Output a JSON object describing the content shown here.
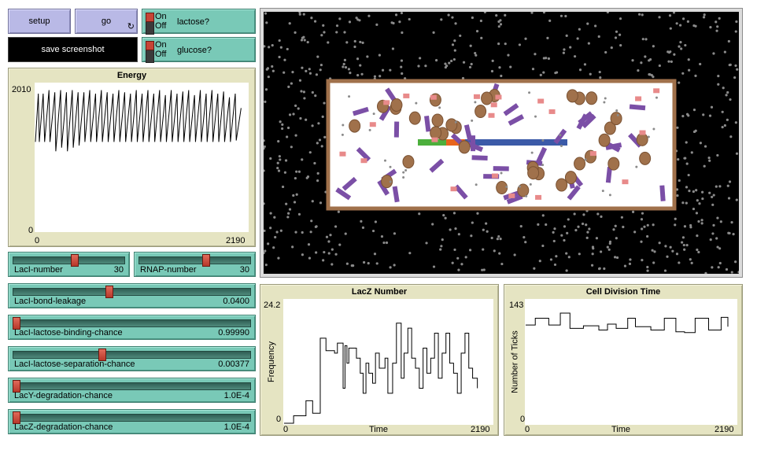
{
  "buttons": {
    "setup": "setup",
    "go": "go",
    "save_screenshot": "save screenshot"
  },
  "switches": [
    {
      "on": "On",
      "off": "Off",
      "label": "lactose?"
    },
    {
      "on": "On",
      "off": "Off",
      "label": "glucose?"
    }
  ],
  "energy_plot": {
    "title": "Energy",
    "y_max": "2010",
    "y_min": "0",
    "x_min": "0",
    "x_max": "2190"
  },
  "sliders": {
    "laci_number": {
      "name": "LacI-number",
      "value": "30",
      "fraction": 0.55
    },
    "rnap_number": {
      "name": "RNAP-number",
      "value": "30",
      "fraction": 0.6
    },
    "laci_bond_leakage": {
      "name": "LacI-bond-leakage",
      "value": "0.0400",
      "fraction": 0.4
    },
    "laci_lactose_binding": {
      "name": "LacI-lactose-binding-chance",
      "value": "0.99990",
      "fraction": 0.0
    },
    "laci_lactose_separation": {
      "name": "LacI-lactose-separation-chance",
      "value": "0.00377",
      "fraction": 0.37
    },
    "lacy_degradation": {
      "name": "LacY-degradation-chance",
      "value": "1.0E-4",
      "fraction": 0.0
    },
    "lacz_degradation": {
      "name": "LacZ-degradation-chance",
      "value": "1.0E-4",
      "fraction": 0.0
    }
  },
  "lacz_plot": {
    "title": "LacZ Number",
    "y_label": "Frequency",
    "x_label": "Time",
    "y_max": "24.2",
    "y_min": "0",
    "x_min": "0",
    "x_max": "2190"
  },
  "division_plot": {
    "title": "Cell Division Time",
    "y_label": "Number of Ticks",
    "x_label": "Time",
    "y_max": "143",
    "y_min": "0",
    "x_min": "0",
    "x_max": "2190"
  },
  "colors": {
    "button": "#b9b9e6",
    "switch": "#79c9b7",
    "plot_bg": "#e5e4c2",
    "cell_wall": "#a0714b",
    "laci": "#7b4fa6",
    "lacy": "#a0714b",
    "lacz": "#e88a8a"
  },
  "chart_data": [
    {
      "type": "line",
      "title": "Energy",
      "xlim": [
        0,
        2190
      ],
      "ylim": [
        0,
        2010
      ],
      "series": [
        {
          "x": [
            0,
            30,
            40,
            80,
            95,
            140,
            150,
            200,
            210,
            260,
            270,
            320,
            330,
            380,
            390,
            440,
            450,
            500,
            510,
            560,
            570,
            620,
            630,
            680,
            690,
            740,
            750,
            800,
            810,
            860,
            870,
            920,
            930,
            980,
            990,
            1040,
            1050,
            1100,
            1110,
            1160,
            1170,
            1220,
            1230,
            1280,
            1290,
            1340,
            1350,
            1400,
            1410,
            1460,
            1470,
            1520,
            1530,
            1580,
            1590,
            1640,
            1650,
            1700,
            1710,
            1760,
            1770,
            1820,
            1830,
            1880,
            1890,
            1940,
            1950,
            2000,
            2010,
            2060,
            2070,
            2120
          ],
          "values": [
            1230,
            1900,
            1230,
            1900,
            1230,
            1950,
            1230,
            1920,
            1100,
            1950,
            1150,
            1920,
            1100,
            1950,
            1150,
            1920,
            1180,
            1920,
            1230,
            1950,
            1230,
            1900,
            1230,
            1950,
            1230,
            1920,
            1230,
            1900,
            1230,
            1950,
            1230,
            1920,
            1230,
            1900,
            1230,
            1950,
            1230,
            1900,
            1230,
            1950,
            1230,
            1900,
            1230,
            1950,
            1230,
            1880,
            1230,
            1950,
            1230,
            1900,
            1230,
            1930,
            1230,
            1950,
            1230,
            1880,
            1230,
            1950,
            1230,
            1900,
            1230,
            1950,
            1230,
            1900,
            1230,
            1930,
            1230,
            1850,
            1230,
            1900,
            1250,
            1700
          ]
        }
      ]
    },
    {
      "type": "line",
      "title": "LacZ Number",
      "xlabel": "Time",
      "ylabel": "Frequency",
      "xlim": [
        0,
        2190
      ],
      "ylim": [
        0,
        24.2
      ],
      "series": [
        {
          "x": [
            0,
            100,
            230,
            300,
            380,
            440,
            530,
            560,
            620,
            640,
            660,
            680,
            760,
            800,
            830,
            860,
            890,
            930,
            960,
            1000,
            1060,
            1090,
            1140,
            1180,
            1230,
            1260,
            1300,
            1340,
            1380,
            1420,
            1460,
            1500,
            1540,
            1580,
            1620,
            1660,
            1700,
            1740,
            1780,
            1820,
            1860,
            1900,
            1940,
            1980,
            2030
          ],
          "values": [
            0,
            1.5,
            4.5,
            2.0,
            17.0,
            14.5,
            14.0,
            16.0,
            7.0,
            15.5,
            12.0,
            15.0,
            13.0,
            10.0,
            6.0,
            12.0,
            10.0,
            8.0,
            14.0,
            11.0,
            13.0,
            6.0,
            12.0,
            20.0,
            9.0,
            14.0,
            19.0,
            13.0,
            11.0,
            7.0,
            15.0,
            10.0,
            13.0,
            18.0,
            9.0,
            14.0,
            18.0,
            12.0,
            10.0,
            6.0,
            14.0,
            18.0,
            11.0,
            9.0,
            7.0
          ]
        }
      ]
    },
    {
      "type": "line",
      "title": "Cell Division Time",
      "xlabel": "Time",
      "ylabel": "Number of Ticks",
      "xlim": [
        0,
        2190
      ],
      "ylim": [
        0,
        143
      ],
      "series": [
        {
          "x": [
            0,
            100,
            240,
            360,
            460,
            600,
            760,
            850,
            940,
            1060,
            1140,
            1300,
            1440,
            1560,
            1650,
            1760,
            1900,
            2030,
            2100
          ],
          "values": [
            116,
            124,
            116,
            130,
            112,
            115,
            110,
            117,
            112,
            124,
            114,
            110,
            124,
            108,
            107,
            124,
            110,
            125,
            114
          ]
        }
      ]
    }
  ]
}
